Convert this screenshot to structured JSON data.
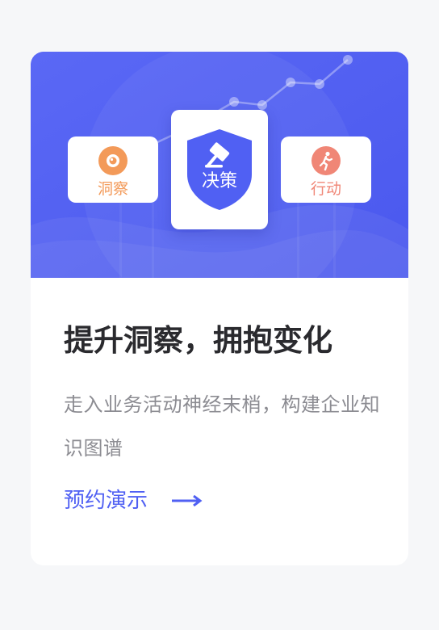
{
  "banner": {
    "tiles": {
      "insight": {
        "label": "洞察",
        "icon": "eye-icon",
        "color": "#f39a59"
      },
      "decision": {
        "label": "决策",
        "icon": "gavel-icon",
        "color": "#5060f3"
      },
      "action": {
        "label": "行动",
        "icon": "running-person-icon",
        "color": "#f08676"
      }
    },
    "background_color": "#5060f3"
  },
  "card": {
    "title": "提升洞察，拥抱变化",
    "description": "走入业务活动神经末梢，构建企业知识图谱",
    "cta": {
      "label": "预约演示",
      "icon": "arrow-right-icon",
      "color": "#5060f3"
    }
  }
}
